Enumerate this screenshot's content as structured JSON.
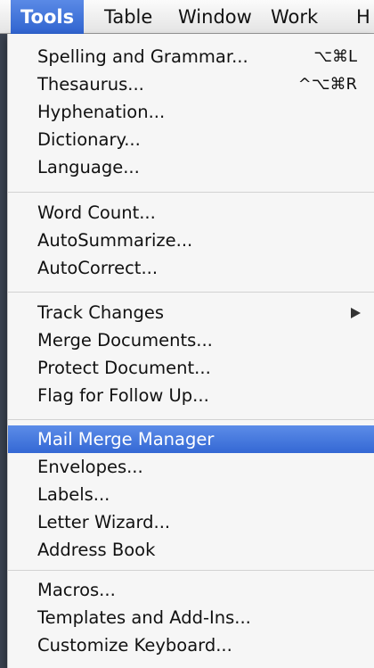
{
  "menubar": {
    "items": [
      {
        "label": "Tools"
      },
      {
        "label": "Table"
      },
      {
        "label": "Window"
      },
      {
        "label": "Work"
      },
      {
        "label": "H"
      }
    ]
  },
  "menu": {
    "groups": [
      {
        "items": [
          {
            "label": "Spelling and Grammar...",
            "shortcut": "⌥⌘L"
          },
          {
            "label": "Thesaurus...",
            "shortcut": "^⌥⌘R"
          },
          {
            "label": "Hyphenation..."
          },
          {
            "label": "Dictionary..."
          },
          {
            "label": "Language..."
          }
        ]
      },
      {
        "items": [
          {
            "label": "Word Count..."
          },
          {
            "label": "AutoSummarize..."
          },
          {
            "label": "AutoCorrect..."
          }
        ]
      },
      {
        "items": [
          {
            "label": "Track Changes"
          },
          {
            "label": "Merge Documents..."
          },
          {
            "label": "Protect Document..."
          },
          {
            "label": "Flag for Follow Up..."
          }
        ]
      },
      {
        "items": [
          {
            "label": "Mail Merge Manager"
          },
          {
            "label": "Envelopes..."
          },
          {
            "label": "Labels..."
          },
          {
            "label": "Letter Wizard..."
          },
          {
            "label": "Address Book"
          }
        ]
      },
      {
        "items": [
          {
            "label": "Macros..."
          },
          {
            "label": "Templates and Add-Ins..."
          },
          {
            "label": "Customize Keyboard..."
          }
        ]
      }
    ]
  }
}
